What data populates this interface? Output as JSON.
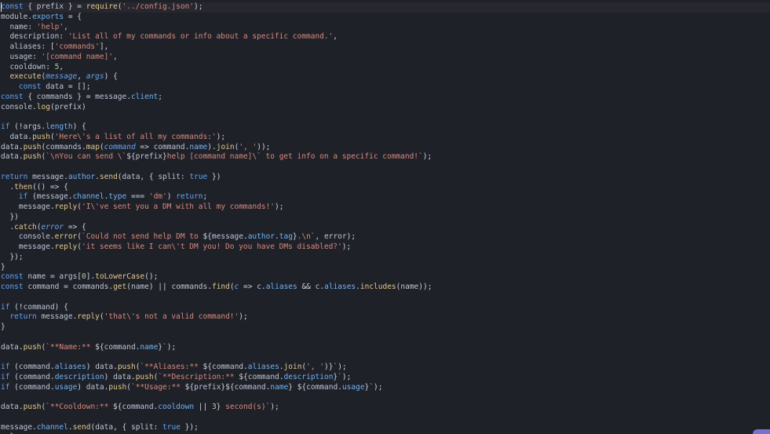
{
  "editor": {
    "colors": {
      "background": "#1f2129",
      "keyword": "#5ea3f4",
      "function": "#e2c98a",
      "string": "#d88a7c",
      "property": "#6fb3f2",
      "number": "#a9d1a0"
    },
    "lines": [
      [
        [
          "k",
          "const"
        ],
        [
          "o",
          " { "
        ],
        [
          "v",
          "prefix"
        ],
        [
          "o",
          " } = "
        ],
        [
          "f",
          "require"
        ],
        [
          "o",
          "("
        ],
        [
          "s",
          "'../config.json'"
        ],
        [
          "o",
          ");"
        ]
      ],
      [
        [
          "v",
          "module"
        ],
        [
          "o",
          "."
        ],
        [
          "p",
          "exports"
        ],
        [
          "o",
          " = {"
        ]
      ],
      [
        [
          "o",
          "  "
        ],
        [
          "v",
          "name"
        ],
        [
          "o",
          ": "
        ],
        [
          "s",
          "'help'"
        ],
        [
          "o",
          ","
        ]
      ],
      [
        [
          "o",
          "  "
        ],
        [
          "v",
          "description"
        ],
        [
          "o",
          ": "
        ],
        [
          "s",
          "'List all of my commands or info about a specific command.'"
        ],
        [
          "o",
          ","
        ]
      ],
      [
        [
          "o",
          "  "
        ],
        [
          "v",
          "aliases"
        ],
        [
          "o",
          ": ["
        ],
        [
          "s",
          "'commands'"
        ],
        [
          "o",
          "],"
        ]
      ],
      [
        [
          "o",
          "  "
        ],
        [
          "v",
          "usage"
        ],
        [
          "o",
          ": "
        ],
        [
          "s",
          "'[command name]'"
        ],
        [
          "o",
          ","
        ]
      ],
      [
        [
          "o",
          "  "
        ],
        [
          "v",
          "cooldown"
        ],
        [
          "o",
          ": "
        ],
        [
          "n",
          "5"
        ],
        [
          "o",
          ","
        ]
      ],
      [
        [
          "o",
          "  "
        ],
        [
          "f",
          "execute"
        ],
        [
          "o",
          "("
        ],
        [
          "pm",
          "message"
        ],
        [
          "o",
          ", "
        ],
        [
          "pm",
          "args"
        ],
        [
          "o",
          ") {"
        ]
      ],
      [
        [
          "o",
          "    "
        ],
        [
          "k",
          "const"
        ],
        [
          "o",
          " "
        ],
        [
          "v",
          "data"
        ],
        [
          "o",
          " = [];"
        ]
      ],
      [
        [
          "k",
          "const"
        ],
        [
          "o",
          " { "
        ],
        [
          "v",
          "commands"
        ],
        [
          "o",
          " } = "
        ],
        [
          "v",
          "message"
        ],
        [
          "o",
          "."
        ],
        [
          "p",
          "client"
        ],
        [
          "o",
          ";"
        ]
      ],
      [
        [
          "v",
          "console"
        ],
        [
          "o",
          "."
        ],
        [
          "f",
          "log"
        ],
        [
          "o",
          "("
        ],
        [
          "v",
          "prefix"
        ],
        [
          "o",
          ")"
        ]
      ],
      [],
      [
        [
          "k",
          "if"
        ],
        [
          "o",
          " (!"
        ],
        [
          "v",
          "args"
        ],
        [
          "o",
          "."
        ],
        [
          "p",
          "length"
        ],
        [
          "o",
          ") {"
        ]
      ],
      [
        [
          "o",
          "  "
        ],
        [
          "v",
          "data"
        ],
        [
          "o",
          "."
        ],
        [
          "f",
          "push"
        ],
        [
          "o",
          "("
        ],
        [
          "s",
          "'Here\\'s a list of all my commands:'"
        ],
        [
          "o",
          ");"
        ]
      ],
      [
        [
          "v",
          "data"
        ],
        [
          "o",
          "."
        ],
        [
          "f",
          "push"
        ],
        [
          "o",
          "("
        ],
        [
          "v",
          "commands"
        ],
        [
          "o",
          "."
        ],
        [
          "f",
          "map"
        ],
        [
          "o",
          "("
        ],
        [
          "pm",
          "command"
        ],
        [
          "o",
          " => "
        ],
        [
          "v",
          "command"
        ],
        [
          "o",
          "."
        ],
        [
          "p",
          "name"
        ],
        [
          "o",
          ")."
        ],
        [
          "f",
          "join"
        ],
        [
          "o",
          "("
        ],
        [
          "s",
          "', '"
        ],
        [
          "o",
          "));"
        ]
      ],
      [
        [
          "v",
          "data"
        ],
        [
          "o",
          "."
        ],
        [
          "f",
          "push"
        ],
        [
          "o",
          "("
        ],
        [
          "s",
          "`\\nYou can send \\`"
        ],
        [
          "o",
          "${"
        ],
        [
          "v",
          "prefix"
        ],
        [
          "o",
          "}"
        ],
        [
          "s",
          "help [command name]\\` to get info on a specific command!`"
        ],
        [
          "o",
          ");"
        ]
      ],
      [],
      [
        [
          "k",
          "return"
        ],
        [
          "o",
          " "
        ],
        [
          "v",
          "message"
        ],
        [
          "o",
          "."
        ],
        [
          "p",
          "author"
        ],
        [
          "o",
          "."
        ],
        [
          "f",
          "send"
        ],
        [
          "o",
          "("
        ],
        [
          "v",
          "data"
        ],
        [
          "o",
          ", { "
        ],
        [
          "v",
          "split"
        ],
        [
          "o",
          ": "
        ],
        [
          "k",
          "true"
        ],
        [
          "o",
          " })"
        ]
      ],
      [
        [
          "o",
          "  ."
        ],
        [
          "f",
          "then"
        ],
        [
          "o",
          "(() => {"
        ]
      ],
      [
        [
          "o",
          "    "
        ],
        [
          "k",
          "if"
        ],
        [
          "o",
          " ("
        ],
        [
          "v",
          "message"
        ],
        [
          "o",
          "."
        ],
        [
          "p",
          "channel"
        ],
        [
          "o",
          "."
        ],
        [
          "p",
          "type"
        ],
        [
          "o",
          " === "
        ],
        [
          "s",
          "'dm'"
        ],
        [
          "o",
          ") "
        ],
        [
          "k",
          "return"
        ],
        [
          "o",
          ";"
        ]
      ],
      [
        [
          "o",
          "    "
        ],
        [
          "v",
          "message"
        ],
        [
          "o",
          "."
        ],
        [
          "f",
          "reply"
        ],
        [
          "o",
          "("
        ],
        [
          "s",
          "'I\\'ve sent you a DM with all my commands!'"
        ],
        [
          "o",
          ");"
        ]
      ],
      [
        [
          "o",
          "  })"
        ]
      ],
      [
        [
          "o",
          "  ."
        ],
        [
          "f",
          "catch"
        ],
        [
          "o",
          "("
        ],
        [
          "pm",
          "error"
        ],
        [
          "o",
          " => {"
        ]
      ],
      [
        [
          "o",
          "    "
        ],
        [
          "v",
          "console"
        ],
        [
          "o",
          "."
        ],
        [
          "f",
          "error"
        ],
        [
          "o",
          "("
        ],
        [
          "s",
          "`Could not send help DM to "
        ],
        [
          "o",
          "${"
        ],
        [
          "v",
          "message"
        ],
        [
          "o",
          "."
        ],
        [
          "p",
          "author"
        ],
        [
          "o",
          "."
        ],
        [
          "p",
          "tag"
        ],
        [
          "o",
          "}"
        ],
        [
          "s",
          ".\\n`"
        ],
        [
          "o",
          ", "
        ],
        [
          "v",
          "error"
        ],
        [
          "o",
          ");"
        ]
      ],
      [
        [
          "o",
          "    "
        ],
        [
          "v",
          "message"
        ],
        [
          "o",
          "."
        ],
        [
          "f",
          "reply"
        ],
        [
          "o",
          "("
        ],
        [
          "s",
          "'it seems like I can\\'t DM you! Do you have DMs disabled?'"
        ],
        [
          "o",
          ");"
        ]
      ],
      [
        [
          "o",
          "  });"
        ]
      ],
      [
        [
          "o",
          "}"
        ]
      ],
      [
        [
          "k",
          "const"
        ],
        [
          "o",
          " "
        ],
        [
          "v",
          "name"
        ],
        [
          "o",
          " = "
        ],
        [
          "v",
          "args"
        ],
        [
          "o",
          "["
        ],
        [
          "n",
          "0"
        ],
        [
          "o",
          "]."
        ],
        [
          "f",
          "toLowerCase"
        ],
        [
          "o",
          "();"
        ]
      ],
      [
        [
          "k",
          "const"
        ],
        [
          "o",
          " "
        ],
        [
          "v",
          "command"
        ],
        [
          "o",
          " = "
        ],
        [
          "v",
          "commands"
        ],
        [
          "o",
          "."
        ],
        [
          "f",
          "get"
        ],
        [
          "o",
          "("
        ],
        [
          "v",
          "name"
        ],
        [
          "o",
          ") || "
        ],
        [
          "v",
          "commands"
        ],
        [
          "o",
          "."
        ],
        [
          "f",
          "find"
        ],
        [
          "o",
          "("
        ],
        [
          "pm",
          "c"
        ],
        [
          "o",
          " => "
        ],
        [
          "v",
          "c"
        ],
        [
          "o",
          "."
        ],
        [
          "p",
          "aliases"
        ],
        [
          "o",
          " && "
        ],
        [
          "v",
          "c"
        ],
        [
          "o",
          "."
        ],
        [
          "p",
          "aliases"
        ],
        [
          "o",
          "."
        ],
        [
          "f",
          "includes"
        ],
        [
          "o",
          "("
        ],
        [
          "v",
          "name"
        ],
        [
          "o",
          "));"
        ]
      ],
      [],
      [
        [
          "k",
          "if"
        ],
        [
          "o",
          " (!"
        ],
        [
          "v",
          "command"
        ],
        [
          "o",
          ") {"
        ]
      ],
      [
        [
          "o",
          "  "
        ],
        [
          "k",
          "return"
        ],
        [
          "o",
          " "
        ],
        [
          "v",
          "message"
        ],
        [
          "o",
          "."
        ],
        [
          "f",
          "reply"
        ],
        [
          "o",
          "("
        ],
        [
          "s",
          "'that\\'s not a valid command!'"
        ],
        [
          "o",
          ");"
        ]
      ],
      [
        [
          "o",
          "}"
        ]
      ],
      [],
      [
        [
          "v",
          "data"
        ],
        [
          "o",
          "."
        ],
        [
          "f",
          "push"
        ],
        [
          "o",
          "("
        ],
        [
          "s",
          "`**Name:** "
        ],
        [
          "o",
          "${"
        ],
        [
          "v",
          "command"
        ],
        [
          "o",
          "."
        ],
        [
          "p",
          "name"
        ],
        [
          "o",
          "}"
        ],
        [
          "s",
          "`"
        ],
        [
          "o",
          ");"
        ]
      ],
      [],
      [
        [
          "k",
          "if"
        ],
        [
          "o",
          " ("
        ],
        [
          "v",
          "command"
        ],
        [
          "o",
          "."
        ],
        [
          "p",
          "aliases"
        ],
        [
          "o",
          ") "
        ],
        [
          "v",
          "data"
        ],
        [
          "o",
          "."
        ],
        [
          "f",
          "push"
        ],
        [
          "o",
          "("
        ],
        [
          "s",
          "`**Aliases:** "
        ],
        [
          "o",
          "${"
        ],
        [
          "v",
          "command"
        ],
        [
          "o",
          "."
        ],
        [
          "p",
          "aliases"
        ],
        [
          "o",
          "."
        ],
        [
          "f",
          "join"
        ],
        [
          "o",
          "("
        ],
        [
          "s",
          "', '"
        ],
        [
          "o",
          ")}"
        ],
        [
          "s",
          "`"
        ],
        [
          "o",
          ");"
        ]
      ],
      [
        [
          "k",
          "if"
        ],
        [
          "o",
          " ("
        ],
        [
          "v",
          "command"
        ],
        [
          "o",
          "."
        ],
        [
          "p",
          "description"
        ],
        [
          "o",
          ") "
        ],
        [
          "v",
          "data"
        ],
        [
          "o",
          "."
        ],
        [
          "f",
          "push"
        ],
        [
          "o",
          "("
        ],
        [
          "s",
          "`**Description:** "
        ],
        [
          "o",
          "${"
        ],
        [
          "v",
          "command"
        ],
        [
          "o",
          "."
        ],
        [
          "p",
          "description"
        ],
        [
          "o",
          "}"
        ],
        [
          "s",
          "`"
        ],
        [
          "o",
          ");"
        ]
      ],
      [
        [
          "k",
          "if"
        ],
        [
          "o",
          " ("
        ],
        [
          "v",
          "command"
        ],
        [
          "o",
          "."
        ],
        [
          "p",
          "usage"
        ],
        [
          "o",
          ") "
        ],
        [
          "v",
          "data"
        ],
        [
          "o",
          "."
        ],
        [
          "f",
          "push"
        ],
        [
          "o",
          "("
        ],
        [
          "s",
          "`**Usage:** "
        ],
        [
          "o",
          "${"
        ],
        [
          "v",
          "prefix"
        ],
        [
          "o",
          "}${"
        ],
        [
          "v",
          "command"
        ],
        [
          "o",
          "."
        ],
        [
          "p",
          "name"
        ],
        [
          "o",
          "} ${"
        ],
        [
          "v",
          "command"
        ],
        [
          "o",
          "."
        ],
        [
          "p",
          "usage"
        ],
        [
          "o",
          "}"
        ],
        [
          "s",
          "`"
        ],
        [
          "o",
          ");"
        ]
      ],
      [],
      [
        [
          "v",
          "data"
        ],
        [
          "o",
          "."
        ],
        [
          "f",
          "push"
        ],
        [
          "o",
          "("
        ],
        [
          "s",
          "`**Cooldown:** "
        ],
        [
          "o",
          "${"
        ],
        [
          "v",
          "command"
        ],
        [
          "o",
          "."
        ],
        [
          "p",
          "cooldown"
        ],
        [
          "o",
          " || "
        ],
        [
          "n",
          "3"
        ],
        [
          "o",
          "}"
        ],
        [
          "s",
          " second(s)`"
        ],
        [
          "o",
          ");"
        ]
      ],
      [],
      [
        [
          "v",
          "message"
        ],
        [
          "o",
          "."
        ],
        [
          "p",
          "channel"
        ],
        [
          "o",
          "."
        ],
        [
          "f",
          "send"
        ],
        [
          "o",
          "("
        ],
        [
          "v",
          "data"
        ],
        [
          "o",
          ", { "
        ],
        [
          "v",
          "split"
        ],
        [
          "o",
          ": "
        ],
        [
          "k",
          "true"
        ],
        [
          "o",
          " });"
        ]
      ],
      [
        [
          "o",
          "  },"
        ]
      ]
    ]
  }
}
